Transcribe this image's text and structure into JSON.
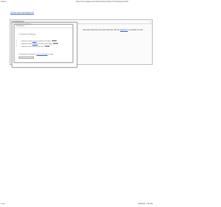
{
  "print_header": {
    "app": "Firefox",
    "url": "https://v3.cengage.com/static/nb/ui/evo/index.html?deploymentId=…"
  },
  "print_footer": {
    "page": "1 of 1",
    "datetime": "6/8/2023, 1:52 PM"
  },
  "top_links": {
    "first": "Journal entries",
    "separator": "and",
    "second": "Adjustments"
  },
  "background_panel": {
    "title": "Comprehensive",
    "text_prefix": "(amounts). Determine the amount that was, after the",
    "text_link": "adjustment",
    "text_suffix": "is recorded, for each.",
    "close": "×"
  },
  "dialog_outer": {
    "title": "Calculation: Trial Balance"
  },
  "dialog_inner": {
    "title": "Trial Balance",
    "intro": "a. Determine the following:",
    "rows": [
      {
        "num": "1.",
        "prefix": "a. Amount of total",
        "link": "assets",
        "suffix": "recorded in the ledger"
      },
      {
        "num": "2.",
        "prefix": "b. Amount of total",
        "link": "liabilities",
        "suffix": "recorded in the ledger"
      },
      {
        "num": "3.",
        "prefix": "c. Amount of net income (or net loss)",
        "link": "",
        "suffix": ""
      }
    ],
    "question_b_prefix": "b. Determine the amount of ",
    "question_b_link": "retained earnings",
    "question_b_suffix": " to report."
  }
}
